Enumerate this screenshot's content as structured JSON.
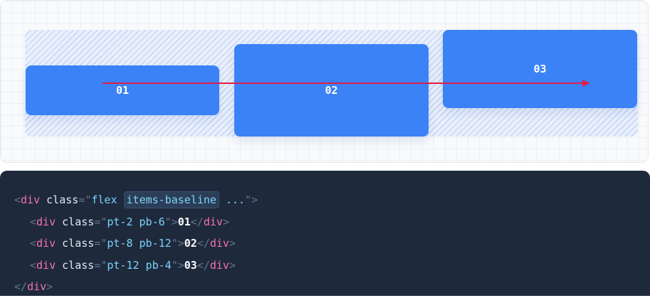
{
  "demo": {
    "items": [
      {
        "label": "01"
      },
      {
        "label": "02"
      },
      {
        "label": "03"
      }
    ],
    "colors": {
      "item": "#3b82f6",
      "baseline_arrow": "#e11d48",
      "stripes": "#c7d7f6"
    }
  },
  "code": {
    "open_tag": "div",
    "class_attr": "class",
    "parent_class_flex": "flex",
    "parent_class_highlight": "items-baseline",
    "parent_class_more": "...",
    "children": [
      {
        "classes": "pt-2 pb-6",
        "text": "01"
      },
      {
        "classes": "pt-8 pb-12",
        "text": "02"
      },
      {
        "classes": "pt-12 pb-4",
        "text": "03"
      }
    ],
    "close_tag": "div"
  }
}
